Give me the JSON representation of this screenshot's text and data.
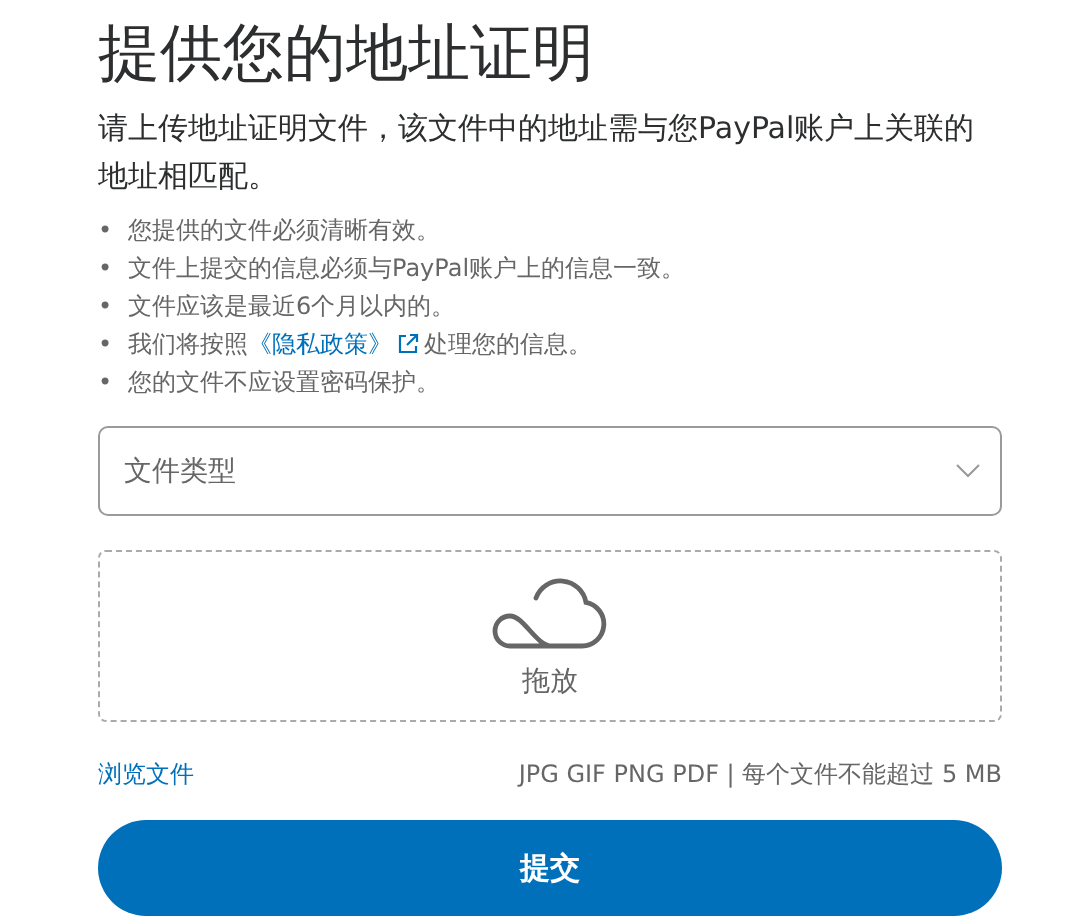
{
  "title": "提供您的地址证明",
  "description": "请上传地址证明文件，该文件中的地址需与您PayPal账户上关联的地址相匹配。",
  "requirements": [
    {
      "kind": "text",
      "bullet": "•",
      "text": "您提供的文件必须清晰有效。"
    },
    {
      "kind": "text",
      "bullet": "•",
      "text": "文件上提交的信息必须与PayPal账户上的信息一致。"
    },
    {
      "kind": "text",
      "bullet": "•",
      "text": "文件应该是最近6个月以内的。"
    },
    {
      "kind": "link",
      "bullet": "•",
      "before": "我们将按照",
      "link": "《隐私政策》",
      "after": "处理您的信息。"
    },
    {
      "kind": "text",
      "bullet": "•",
      "text": "您的文件不应设置密码保护。"
    }
  ],
  "document_type": {
    "placeholder": "文件类型"
  },
  "drop_zone": {
    "label": "拖放"
  },
  "browse_link": "浏览文件",
  "file_hint": "JPG GIF PNG PDF | 每个文件不能超过 5 MB",
  "submit_button": "提交"
}
